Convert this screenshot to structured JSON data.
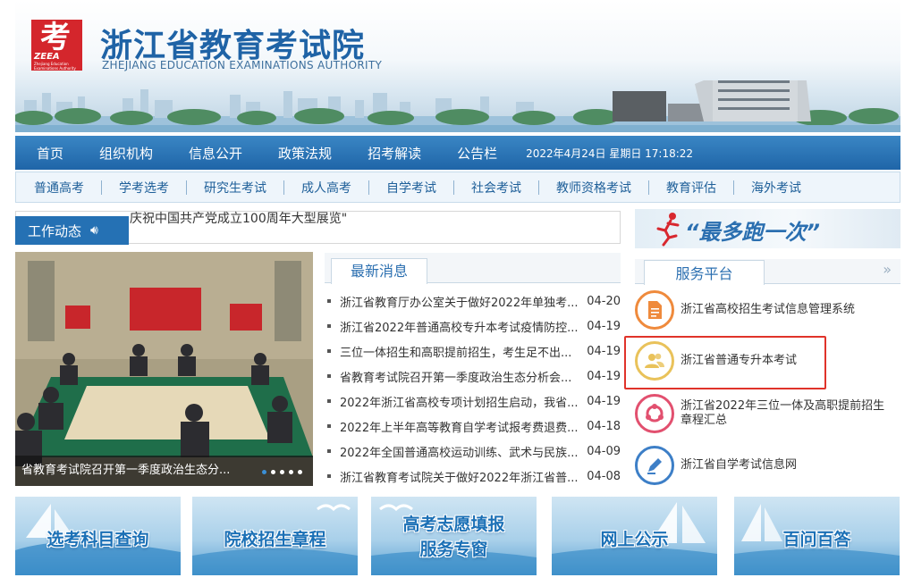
{
  "header": {
    "logo_glyph": "考",
    "logo_abbr": "ZEEA",
    "logo_small": "Zhejiang Education Examinations Authority",
    "title": "浙江省教育考试院",
    "subtitle": "ZHEJIANG EDUCATION EXAMINATIONS AUTHORITY"
  },
  "main_nav": {
    "items": [
      "首页",
      "组织机构",
      "信息公开",
      "政策法规",
      "招考解读",
      "公告栏"
    ],
    "datetime": "2022年4月24日 星期日 17:18:22"
  },
  "sub_nav": {
    "items": [
      "普通高考",
      "学考选考",
      "研究生考试",
      "成人高考",
      "自学考试",
      "社会考试",
      "教师资格考试",
      "教育评估",
      "海外考试"
    ]
  },
  "ticker": {
    "label": "工作动态",
    "text": "庆祝中国共产党成立100周年大型展览\""
  },
  "banner_ad": {
    "text": "“最多跑一次”"
  },
  "photo": {
    "caption": "省教育考试院召开第一季度政治生态分...",
    "slide_count": 5,
    "active_slide": 1
  },
  "news": {
    "tab": "最新消息",
    "items": [
      {
        "title": "浙江省教育厅办公室关于做好2022年单独考...",
        "date": "04-20"
      },
      {
        "title": "浙江省2022年普通高校专升本考试疫情防控...",
        "date": "04-19"
      },
      {
        "title": "三位一体招生和高职提前招生，考生足不出...",
        "date": "04-19"
      },
      {
        "title": "省教育考试院召开第一季度政治生态分析会...",
        "date": "04-19"
      },
      {
        "title": "2022年浙江省高校专项计划招生启动，我省...",
        "date": "04-19"
      },
      {
        "title": "2022年上半年高等教育自学考试报考费退费...",
        "date": "04-18"
      },
      {
        "title": "2022年全国普通高校运动训练、武术与民族...",
        "date": "04-09"
      },
      {
        "title": "浙江省教育考试院关于做好2022年浙江省普...",
        "date": "04-08"
      }
    ]
  },
  "service": {
    "tab": "服务平台",
    "more": "»",
    "items": [
      {
        "label": "浙江省高校招生考试信息管理系统",
        "icon": "document-icon",
        "color": "#ef8a3c"
      },
      {
        "label": "浙江省普通专升本考试",
        "icon": "users-icon",
        "color": "#e9c25a"
      },
      {
        "label": "浙江省2022年三位一体及高职提前招生章程汇总",
        "icon": "cycle-icon",
        "color": "#e2506f"
      },
      {
        "label": "浙江省自学考试信息网",
        "icon": "pen-icon",
        "color": "#3d7fc7"
      }
    ]
  },
  "tiles": [
    {
      "line1": "选考科目查询",
      "line2": ""
    },
    {
      "line1": "院校招生章程",
      "line2": ""
    },
    {
      "line1": "高考志愿填报",
      "line2": "服务专窗"
    },
    {
      "line1": "网上公示",
      "line2": ""
    },
    {
      "line1": "百问百答",
      "line2": ""
    }
  ]
}
